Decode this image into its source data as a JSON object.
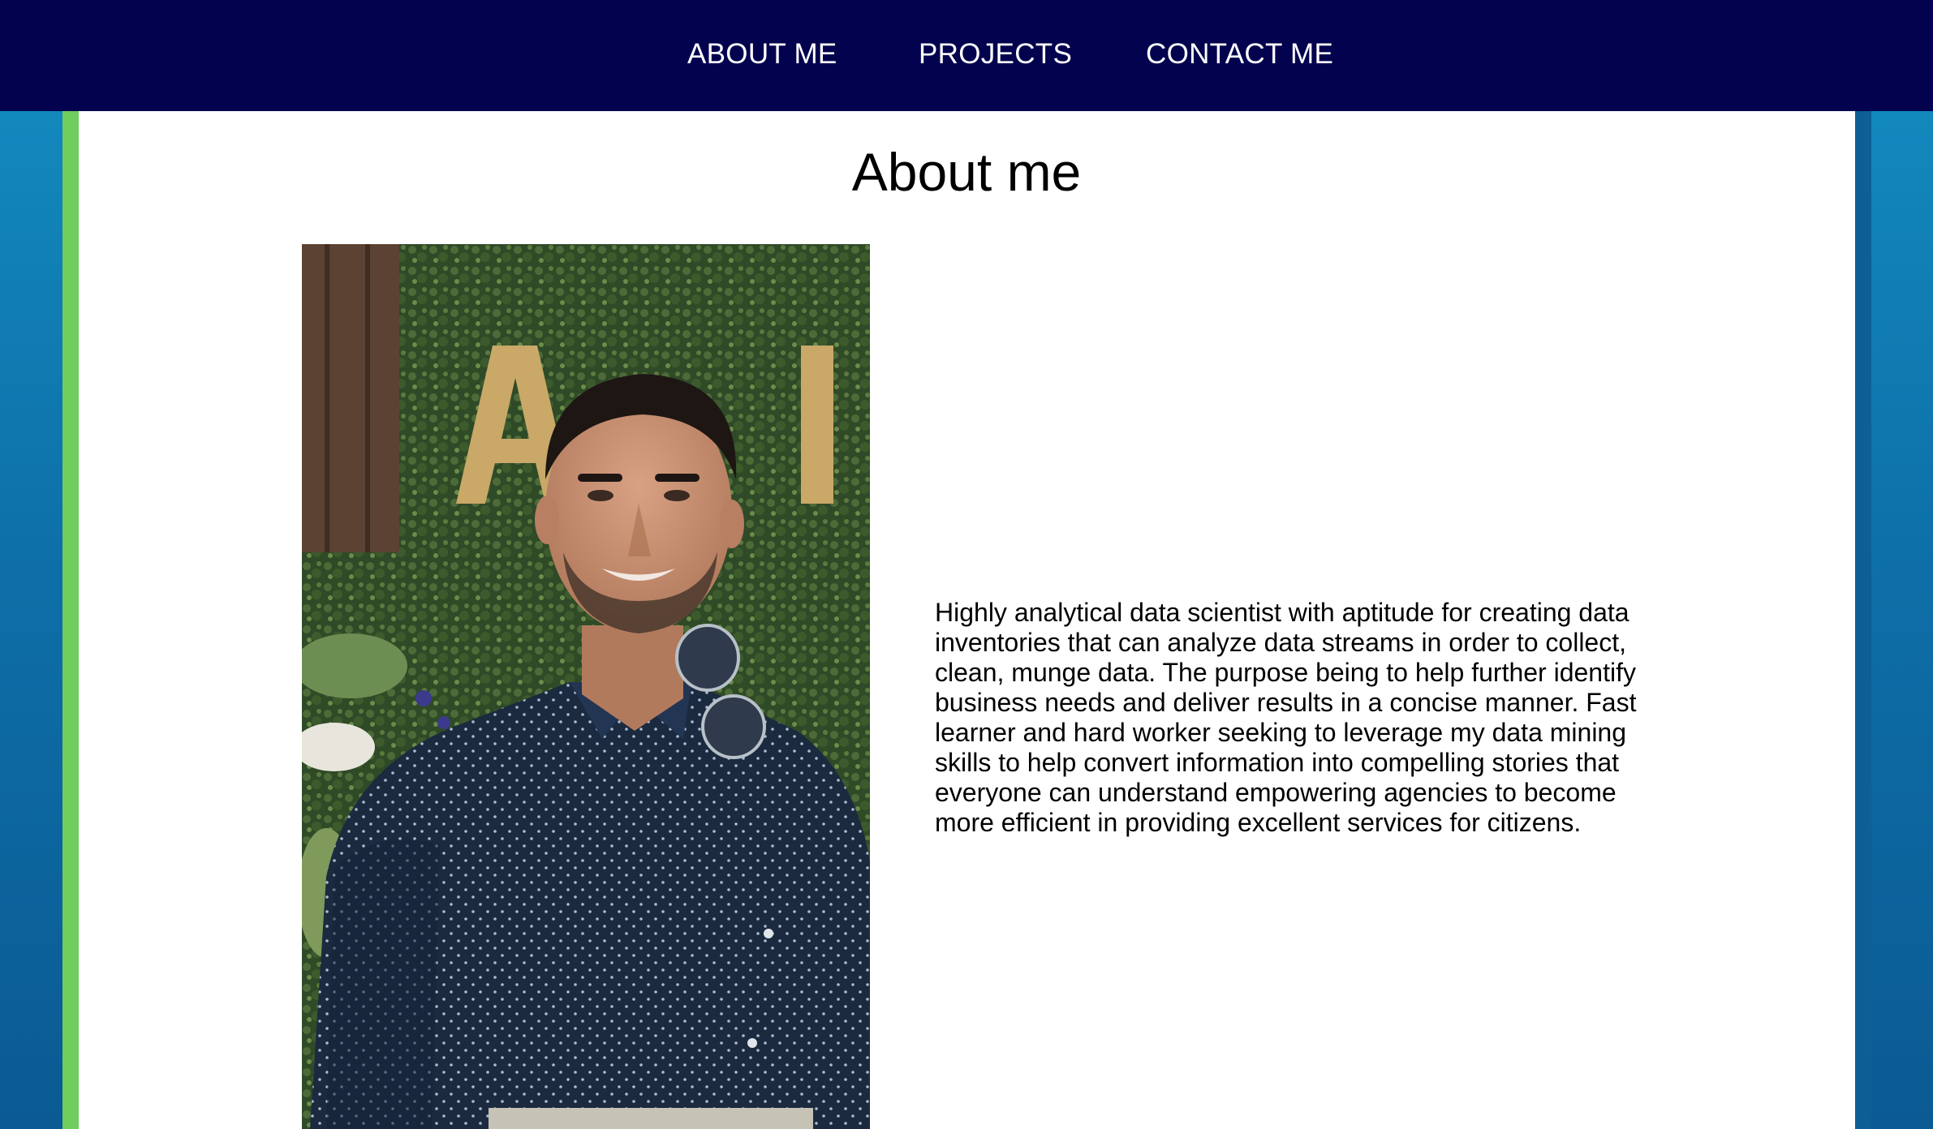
{
  "nav": {
    "items": [
      "ABOUT ME",
      "PROJECTS",
      "CONTACT ME"
    ]
  },
  "about": {
    "title": "About me",
    "bio": "Highly analytical data scientist with aptitude for creating data inventories that can analyze data streams in order to collect, clean, munge data. The purpose being to help further identify business needs and deliver results in a concise manner. Fast learner and hard worker seeking to leverage my data mining skills to help convert information into compelling stories that everyone can understand empowering agencies to become more efficient in providing excellent services for citizens."
  },
  "colors": {
    "navbar": "#02024e",
    "page_gradient_top": "#138ec2",
    "page_gradient_bottom": "#0b5a93",
    "accent_green": "#6fce5e",
    "panel": "#ffffff"
  }
}
